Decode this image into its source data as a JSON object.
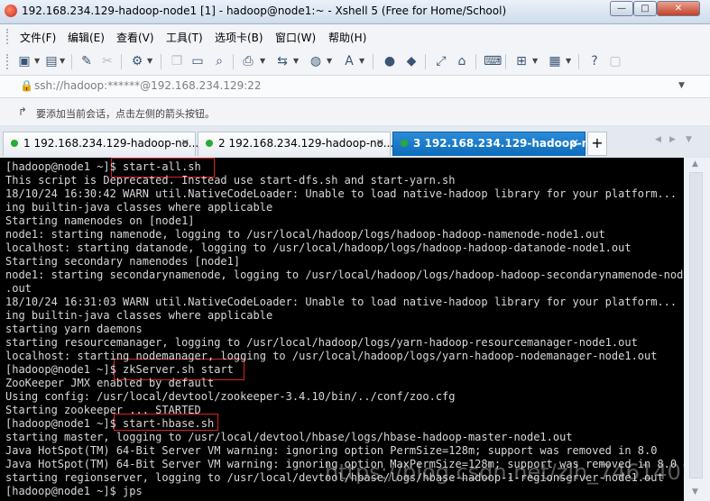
{
  "window": {
    "title": "192.168.234.129-hadoop-node1 [1] - hadoop@node1:~ - Xshell 5 (Free for Home/School)",
    "min_label": "—",
    "max_label": "□",
    "close_label": "✕"
  },
  "menu": [
    "文件(F)",
    "编辑(E)",
    "查看(V)",
    "工具(T)",
    "选项卡(B)",
    "窗口(W)",
    "帮助(H)"
  ],
  "address": {
    "lock_icon": "🔒",
    "text": "ssh://hadoop:******@192.168.234.129:22"
  },
  "hint": {
    "icon": "arrow-icon",
    "text": "要添加当前会话，点击左侧的箭头按钮。"
  },
  "tabs": [
    {
      "label": "1 192.168.234.129-hadoop-no...",
      "active": false
    },
    {
      "label": "2 192.168.234.129-hadoop-no...",
      "active": false
    },
    {
      "label": "3 192.168.234.129-hadoop-n...",
      "active": true
    }
  ],
  "tab_add": "+",
  "terminal": {
    "lines": [
      "[hadoop@node1 ~]$ start-all.sh",
      "This script is Deprecated. Instead use start-dfs.sh and start-yarn.sh",
      "18/10/24 16:30:42 WARN util.NativeCodeLoader: Unable to load native-hadoop library for your platform... us",
      "ing builtin-java classes where applicable",
      "Starting namenodes on [node1]",
      "node1: starting namenode, logging to /usr/local/hadoop/logs/hadoop-hadoop-namenode-node1.out",
      "localhost: starting datanode, logging to /usr/local/hadoop/logs/hadoop-hadoop-datanode-node1.out",
      "Starting secondary namenodes [node1]",
      "node1: starting secondarynamenode, logging to /usr/local/hadoop/logs/hadoop-hadoop-secondarynamenode-node1",
      ".out",
      "18/10/24 16:31:03 WARN util.NativeCodeLoader: Unable to load native-hadoop library for your platform... us",
      "ing builtin-java classes where applicable",
      "starting yarn daemons",
      "starting resourcemanager, logging to /usr/local/hadoop/logs/yarn-hadoop-resourcemanager-node1.out",
      "localhost: starting nodemanager, logging to /usr/local/hadoop/logs/yarn-hadoop-nodemanager-node1.out",
      "[hadoop@node1 ~]$ zkServer.sh start",
      "ZooKeeper JMX enabled by default",
      "Using config: /usr/local/devtool/zookeeper-3.4.10/bin/../conf/zoo.cfg",
      "Starting zookeeper ... STARTED",
      "[hadoop@node1 ~]$ start-hbase.sh",
      "starting master, logging to /usr/local/devtool/hbase/logs/hbase-hadoop-master-node1.out",
      "Java HotSpot(TM) 64-Bit Server VM warning: ignoring option PermSize=128m; support was removed in 8.0",
      "Java HotSpot(TM) 64-Bit Server VM warning: ignoring option MaxPermSize=128m; support was removed in 8.0",
      "starting regionserver, logging to /usr/local/devtool/hbase/logs/hbase-hadoop-1-regionserver-node1.out",
      "[hadoop@node1 ~]$ jps"
    ]
  },
  "watermark": "https://blog.csdn.net/zjh_746140129",
  "colors": {
    "terminal_bg": "#000000",
    "terminal_fg": "#d8d8d8",
    "highlight": "#d81f26",
    "active_tab": "#0c6cbb"
  }
}
